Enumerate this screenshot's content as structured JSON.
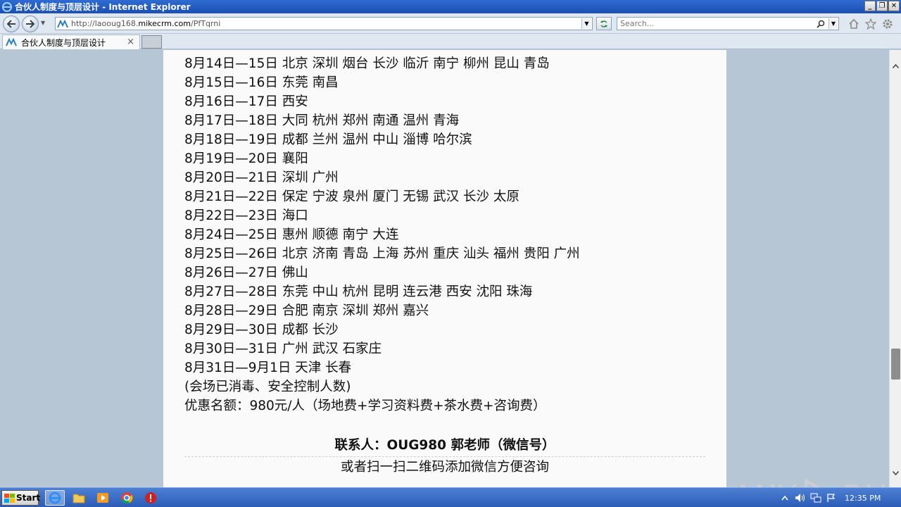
{
  "window": {
    "title": "合伙人制度与顶层设计 - Internet Explorer",
    "controls": [
      "_",
      "❐",
      "✕"
    ]
  },
  "nav": {
    "url_prefix": "http://laooug168.",
    "url_host": "mikecrm.com",
    "url_path": "/PfTqrni",
    "search_placeholder": "Search..."
  },
  "tabs": [
    {
      "label": "合伙人制度与顶层设计"
    }
  ],
  "content": {
    "schedule": [
      "8月14日—15日 北京 深圳 烟台 长沙 临沂 南宁 柳州 昆山 青岛",
      "8月15日—16日 东莞 南昌",
      "8月16日—17日 西安",
      "8月17日—18日 大同 杭州 郑州 南通 温州 青海",
      "8月18日—19日 成都 兰州 温州 中山 淄博 哈尔滨",
      "8月19日—20日 襄阳",
      "8月20日—21日 深圳 广州",
      "8月21日—22日 保定 宁波 泉州 厦门 无锡 武汉 长沙 太原",
      "8月22日—23日 海口",
      "8月24日—25日 惠州 顺德 南宁 大连",
      "8月25日—26日 北京 济南 青岛 上海 苏州 重庆 汕头 福州 贵阳 广州",
      "8月26日—27日 佛山",
      "8月27日—28日 东莞 中山 杭州 昆明 连云港 西安 沈阳 珠海",
      "8月28日—29日 合肥 南京 深圳 郑州 嘉兴",
      "8月29日—30日 成都 长沙",
      "8月30日—31日 广州 武汉 石家庄",
      "8月31日—9月1日 天津 长春",
      " (会场已消毒、安全控制人数)",
      "优惠名额：980元/人（场地费+学习资料费+茶水费+咨询费）"
    ],
    "contact": "联系人：OUG980 郭老师（微信号）",
    "qr_note": "或者扫一扫二维码添加微信方便咨询"
  },
  "watermark": {
    "left": "ANY",
    "right": "RUN"
  },
  "taskbar": {
    "start_label": "Start",
    "clock": "12:35 PM",
    "apps": [
      "ie-icon",
      "folder-icon",
      "media-player-icon",
      "chrome-icon",
      "stop-icon"
    ]
  }
}
